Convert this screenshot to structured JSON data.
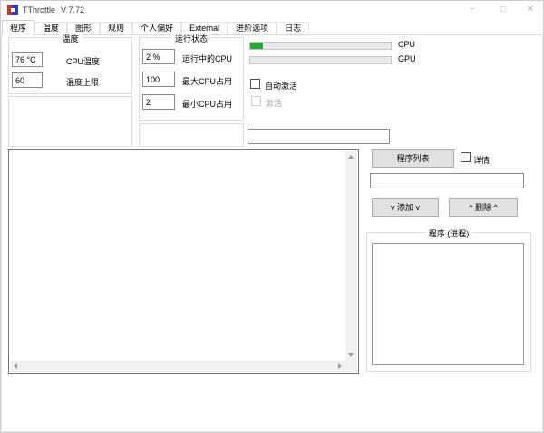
{
  "window": {
    "title": "TThrottle",
    "version": "V 7.72",
    "minimize_glyph": "−",
    "maximize_glyph": "□",
    "close_glyph": "✕"
  },
  "tabs": [
    {
      "label": "程序",
      "selected": true
    },
    {
      "label": "温度",
      "selected": false
    },
    {
      "label": "图形",
      "selected": false
    },
    {
      "label": "规则",
      "selected": false
    },
    {
      "label": "个人偏好",
      "selected": false
    },
    {
      "label": "External",
      "selected": false
    },
    {
      "label": "进阶选项",
      "selected": false
    },
    {
      "label": "日志",
      "selected": false
    }
  ],
  "temperature_group": {
    "title": "温度",
    "cpu_temp_value": "76 °C",
    "cpu_temp_label": "CPU温度",
    "limit_value": "60",
    "limit_label": "温度上限"
  },
  "status_group": {
    "title": "运行状态",
    "running_value": "2 %",
    "running_label": "运行中的CPU",
    "max_value": "100",
    "max_label": "最大CPU占用",
    "min_value": "2",
    "min_label": "最小CPU占用"
  },
  "monitors": {
    "cpu_label": "CPU",
    "cpu_percent": 9,
    "gpu_label": "GPU",
    "gpu_percent": 0
  },
  "checkboxes": {
    "auto_activate_label": "自动激活",
    "activate_label": "激活",
    "details_label": "详情"
  },
  "fields": {
    "status_text": "",
    "program_name": ""
  },
  "buttons": {
    "program_list": "程序列表",
    "add": "v 添加 v",
    "remove": "^ 删除 ^"
  },
  "process_group": {
    "title": "程序 (进程)"
  },
  "colors": {
    "progress_green": "#29a838",
    "button_face": "#e1e1e1",
    "group_border": "#dcdcdc"
  }
}
